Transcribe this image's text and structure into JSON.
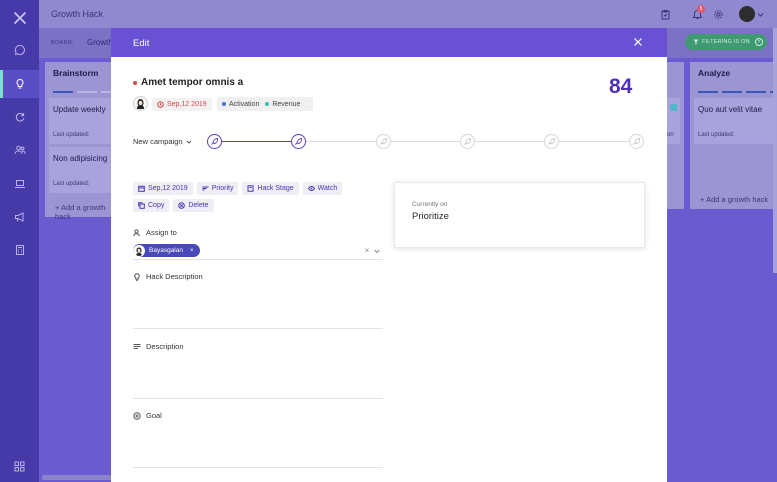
{
  "app": {
    "title": "Growth Hack",
    "notification_count": "5",
    "board_label": "BOARD:",
    "board_name": "Growth",
    "filter_label": "FILTERING IS ON"
  },
  "sidebar": {
    "items": [
      {
        "icon": "chat-icon"
      },
      {
        "icon": "lightbulb-icon",
        "active": true
      },
      {
        "icon": "refresh-icon"
      },
      {
        "icon": "users-icon"
      },
      {
        "icon": "laptop-icon"
      },
      {
        "icon": "megaphone-icon"
      },
      {
        "icon": "calculator-icon"
      },
      {
        "icon": "grid-icon"
      }
    ]
  },
  "board": {
    "columns": [
      {
        "title": "Brainstorm",
        "cards": [
          {
            "title": "Update weekly",
            "meta": "Last updated:"
          },
          {
            "title": "Non adipisicing",
            "meta": "Last updated:"
          }
        ],
        "add_label": "Add a growth hack"
      },
      {
        "title": "Analyze",
        "cards": [
          {
            "title": "Quo aut velit vitae",
            "meta": "Last updated:"
          }
        ],
        "add_label": "Add a growth hack"
      }
    ],
    "partial_card_meta": "on"
  },
  "modal": {
    "header_title": "Edit",
    "hack_title": "Amet tempor omnis a",
    "score": "84",
    "date": "Sep,12 2019",
    "tags": [
      {
        "label": "Activation",
        "color": "#3b78e7"
      },
      {
        "label": "Revenue",
        "color": "#37c2b0"
      }
    ],
    "campaign": "New campaign",
    "stages": [
      {
        "done": true
      },
      {
        "done": true
      },
      {
        "done": false
      },
      {
        "done": false
      },
      {
        "done": false
      },
      {
        "done": false
      }
    ],
    "actions_row1": [
      {
        "icon": "calendar-icon",
        "label": "Sep,12 2019"
      },
      {
        "icon": "priority-icon",
        "label": "Priority"
      },
      {
        "icon": "stage-icon",
        "label": "Hack Stage"
      },
      {
        "icon": "watch-icon",
        "label": "Watch"
      }
    ],
    "actions_row2": [
      {
        "icon": "copy-icon",
        "label": "Copy"
      },
      {
        "icon": "delete-icon",
        "label": "Delete"
      }
    ],
    "status": {
      "label": "Currently on",
      "value": "Prioritize"
    },
    "assign_label": "Assign to",
    "assignee": "Bayasgalan",
    "hack_description_label": "Hack Description",
    "description_label": "Description",
    "goal_label": "Goal"
  },
  "colors": {
    "sidebar": "#453aa8",
    "modal_header": "#6951d3",
    "score": "#4e2fb8",
    "accent": "#5c3ec4",
    "danger": "#e04848"
  }
}
